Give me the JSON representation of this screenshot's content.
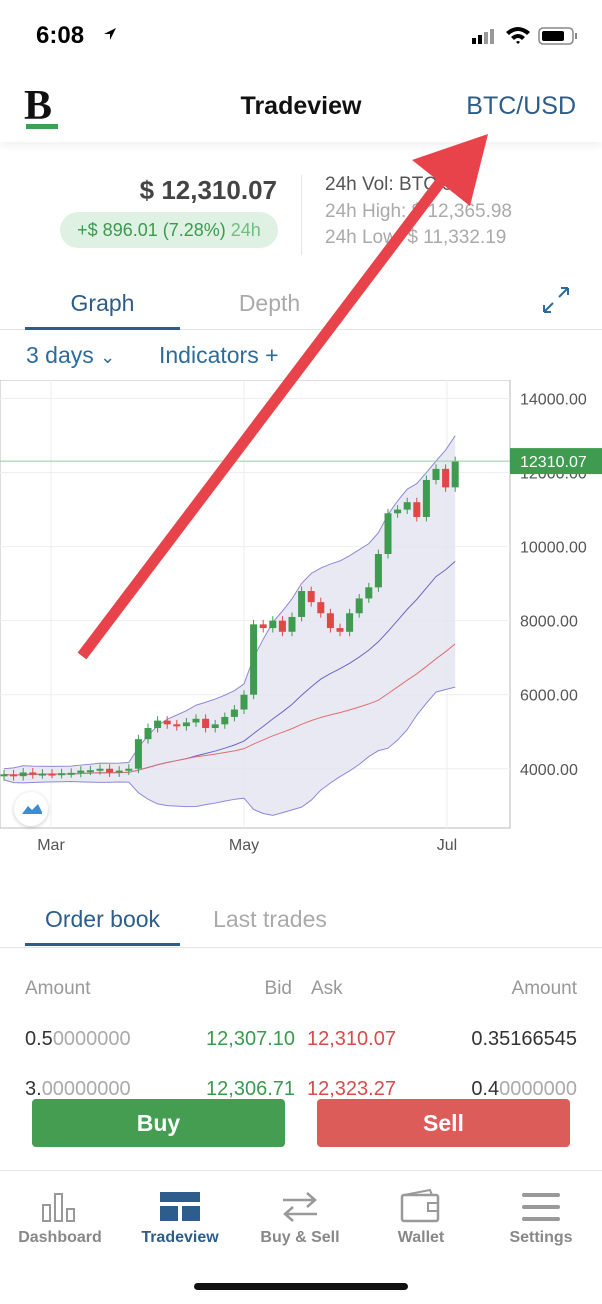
{
  "status_bar": {
    "time": "6:08"
  },
  "header": {
    "title": "Tradeview",
    "pair": "BTC/USD",
    "logo": "B"
  },
  "ticker": {
    "price": "$ 12,310.07",
    "change": "+$ 896.01 (7.28%)",
    "change_period": "24h",
    "volume": "24h Vol: BTC 589",
    "high": "24h High: $ 12,365.98",
    "low": "24h Low: $ 11,332.19"
  },
  "chart_tabs": [
    {
      "label": "Graph",
      "active": true
    },
    {
      "label": "Depth",
      "active": false
    }
  ],
  "range": {
    "label": "3 days",
    "indicators": "Indicators"
  },
  "chart_data": {
    "type": "candlestick",
    "x_ticks": [
      "Mar",
      "May",
      "Jul"
    ],
    "y_ticks": [
      "14000.00",
      "12000.00",
      "10000.00",
      "8000.00",
      "6000.00",
      "4000.00"
    ],
    "ylim": [
      2400,
      14500
    ],
    "current_price_label": "12310.07",
    "closes": [
      3850,
      3800,
      3900,
      3850,
      3870,
      3860,
      3880,
      3890,
      3950,
      3960,
      4000,
      3900,
      3950,
      4000,
      4800,
      5100,
      5300,
      5200,
      5150,
      5250,
      5350,
      5100,
      5200,
      5400,
      5600,
      6000,
      7900,
      7800,
      8000,
      7700,
      8100,
      8800,
      8500,
      8200,
      7800,
      7700,
      8200,
      8600,
      8900,
      9800,
      10900,
      11000,
      11200,
      10800,
      11800,
      12100,
      11600,
      12310
    ],
    "colors": {
      "up": "#3e9b4f",
      "down": "#e04848",
      "band_fill": "#e4e3f0",
      "band_line": "#8c88d8",
      "ma_line": "#e07070"
    }
  },
  "order_book": {
    "tabs": [
      {
        "label": "Order book",
        "active": true
      },
      {
        "label": "Last trades",
        "active": false
      }
    ],
    "headers": [
      "Amount",
      "Bid",
      "Ask",
      "Amount"
    ],
    "rows": [
      {
        "bid_amount": "0.5",
        "bid_amount_pad": "0000000",
        "bid": "12,307.10",
        "ask": "12,310.07",
        "ask_amount": "0.35166545",
        "ask_amount_pad": ""
      },
      {
        "bid_amount": "3.",
        "bid_amount_pad": "00000000",
        "bid": "12,306.71",
        "ask": "12,323.27",
        "ask_amount": "0.4",
        "ask_amount_pad": "0000000"
      }
    ]
  },
  "actions": {
    "buy": "Buy",
    "sell": "Sell"
  },
  "nav": [
    {
      "label": "Dashboard"
    },
    {
      "label": "Tradeview",
      "active": true
    },
    {
      "label": "Buy & Sell"
    },
    {
      "label": "Wallet"
    },
    {
      "label": "Settings"
    }
  ]
}
